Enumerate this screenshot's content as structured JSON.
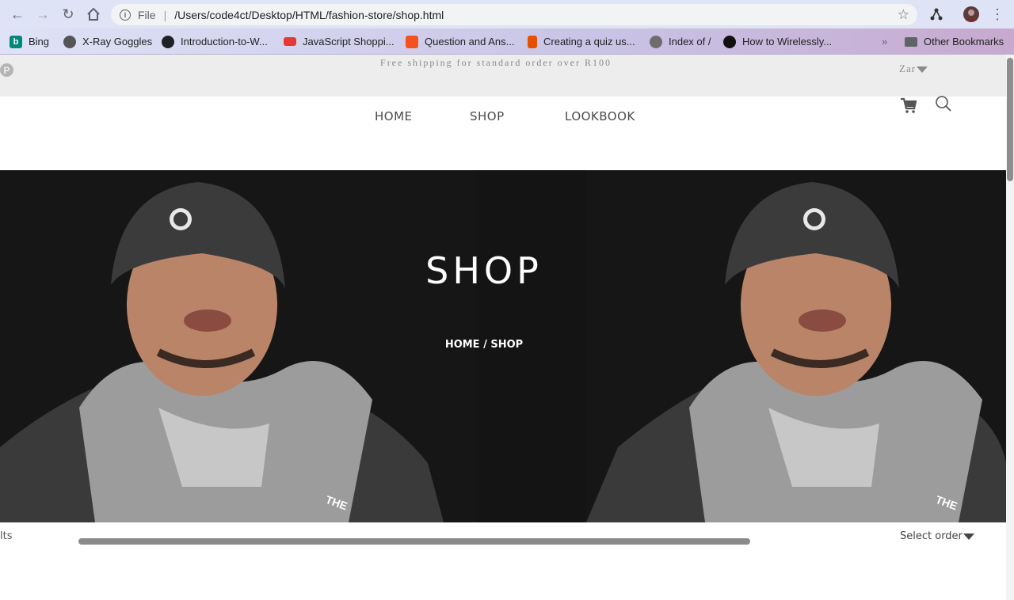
{
  "browser": {
    "scheme": "File",
    "url": "/Users/code4ct/Desktop/HTML/fashion-store/shop.html",
    "bookmarks": [
      {
        "label": "Bing",
        "color": "#00897b"
      },
      {
        "label": "X-Ray Goggles",
        "color": "#555555"
      },
      {
        "label": "Introduction-to-W...",
        "color": "#202124"
      },
      {
        "label": "JavaScript Shoppi...",
        "color": "#e53935"
      },
      {
        "label": "Question and Ans...",
        "color": "#f4511e"
      },
      {
        "label": "Creating a quiz us...",
        "color": "#e65100"
      },
      {
        "label": "Index of /",
        "color": "#6d6d6d"
      },
      {
        "label": "How to Wirelessly...",
        "color": "#111111"
      }
    ],
    "overflow": "»",
    "other_bookmarks": "Other Bookmarks"
  },
  "topbar": {
    "shipping": "Free shipping for standard order over R100",
    "currency": "Zar"
  },
  "nav": {
    "home": "HOME",
    "shop": "SHOP",
    "lookbook": "LOOKBOOK"
  },
  "hero": {
    "title": "SHOP",
    "breadcrumb": "HOME / SHOP"
  },
  "toolbar": {
    "results": "lts",
    "select_order": "Select order"
  }
}
